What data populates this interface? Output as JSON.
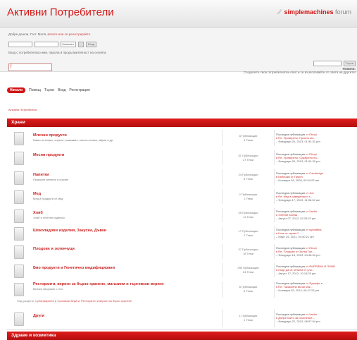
{
  "header": {
    "site_title": "Активни Потребители",
    "logo_brand": "simplemachines",
    "logo_suffix": "forum"
  },
  "userbar": {
    "greeting": "Добре дошли, Гост. Моля,",
    "greeting_link": "влезте или се регистрирайте.",
    "login_select": "Завинаги",
    "login_button": "Вход",
    "note": "Вход с потребителско име, парола и продължителност на сесията",
    "search_button": "Търси",
    "news_label": "Новини:",
    "news_text": "Споделете своя потребителски опит и се възползвайте от опита на другите!"
  },
  "menu": {
    "items": [
      "Начало",
      "Помощ",
      "Търси",
      "Вход",
      "Регистрация"
    ]
  },
  "breadcrumb": "Активни Потребители",
  "categories": [
    {
      "title": "Храни"
    },
    {
      "title": "Здраве и козметика"
    }
  ],
  "boards": [
    {
      "name": "Млечни продукти",
      "desc": "Какво за мляко, сирене, кашкавал, кисело мляко, айрян и др.",
      "stats": "8 Публикации",
      "topics": "4 Теми",
      "lp_label": "Последна публикация",
      "lp_by": "от Etropi",
      "lp_in": "в Re: Проверено: Прясно мл...",
      "lp_date": "– Февруари 25, 2013, 01:54:32 pm"
    },
    {
      "name": "Месни продукти",
      "desc": "",
      "stats": "51 Публикации",
      "topics": "27 Теми",
      "lp_label": "Последна публикация",
      "lp_by": "от Etropi",
      "lp_in": "в Re: Проверено: Одобрено на...",
      "lp_date": "– Февруари 25, 2013, 01:54:32 pm"
    },
    {
      "name": "Напитки",
      "desc": "Газирани напитки и сокове",
      "stats": "24 Публикации",
      "topics": "8 Теми",
      "lp_label": "Последна публикация",
      "lp_by": "от Cambridge",
      "lp_in": "в Бебешки от Пирин",
      "lp_date": "– Ноември 28, 2008, 09:54:23 am"
    },
    {
      "name": "Мед",
      "desc": "Мед и продукти от мед",
      "stats": "2 Публикации",
      "topics": "1 Теми",
      "lp_label": "Последна публикация",
      "lp_by": "от Joe",
      "lp_in": "в Re: Мед в заведения и т...",
      "lp_date": "– Февруари 17, 2013, 11:08:32 am"
    },
    {
      "name": "Хляб",
      "desc": "Хляб и тестени изделия",
      "stats": "35 Публикации",
      "topics": "11 Теми",
      "lp_label": "Последна публикация",
      "lp_by": "от Vazhir",
      "lp_in": "в Хлебни Бонаж",
      "lp_date": "– Август 07, 2012, 02:25:23 pm"
    },
    {
      "name": "Шоколадови изделия, Закуски, Дъвки",
      "desc": "",
      "stats": "17 Публикации",
      "topics": "2 Теми",
      "lp_label": "Последна публикация",
      "lp_by": "от syntrafika",
      "lp_in": "в Кога се гарант?",
      "lp_date": "– Март 25, 2011, 04:40:21 pm"
    },
    {
      "name": "Плодове и зеленчуци",
      "desc": "",
      "stats": "37 Публикации",
      "topics": "18 Теми",
      "lp_label": "Последна публикация",
      "lp_by": "от Etropi",
      "lp_in": "в Re: Плодове от Затър Гуп...",
      "lp_date": "– Февруари 18, 2013, 04:46:03 pm"
    },
    {
      "name": "Био продукти и Генетично модифицирани",
      "desc": "",
      "stats": "296 Публикации",
      "topics": "54 Теми",
      "lp_label": "Последна публикация",
      "lp_by": "от ФИРЕЙНИ И ПОИВ",
      "lp_in": "в Къде да се отнеем от ули...",
      "lp_date": "– Август 17, 2012, 10:16:25 pm"
    },
    {
      "name": "Ресторанти, вериги за бързо хранене, магазини и търговски вериги",
      "desc": "Всичко свързано с сгм",
      "stats": "8 Публикации",
      "topics": "8 Теми",
      "lp_label": "Последна публикация",
      "lp_by": "от Ядлифе е",
      "lp_in": "в Re: Такаконно вънзе изк...",
      "lp_date": "– Ноември 25, 2013, 05:47:23 pm",
      "child_label": "Под-раздели:",
      "children": "Супермаркети и търговски вериги, Ресторанти и вериги за бързо хранене"
    },
    {
      "name": "Други",
      "desc": "",
      "stats": "1 Публикации",
      "topics": "1 Теми",
      "lp_label": "Последна публикация",
      "lp_by": "от Vazhir",
      "lp_in": "в Добре Шито за изяснение...",
      "lp_date": "– Февруари 22, 2013, 08:57:54 pm"
    }
  ]
}
